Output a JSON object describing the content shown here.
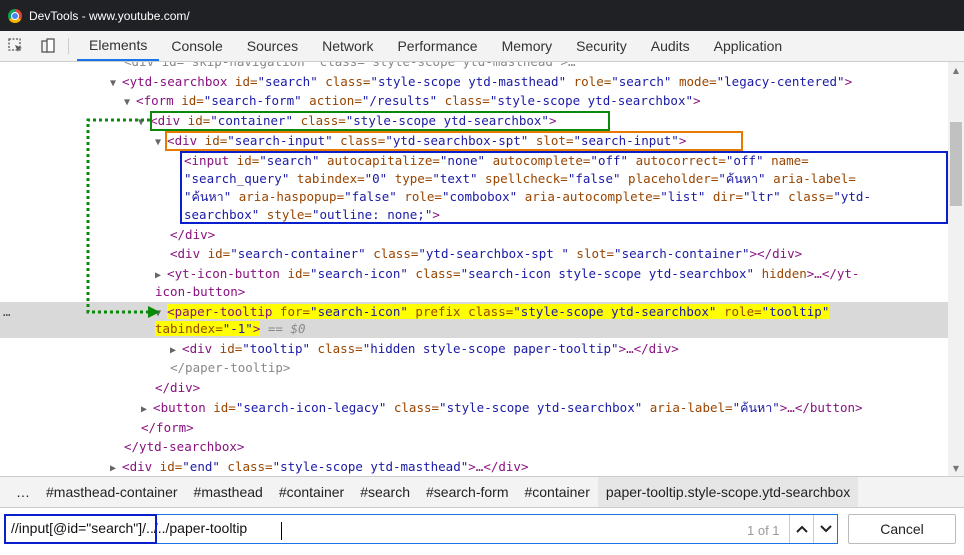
{
  "window": {
    "title": "DevTools - www.youtube.com/"
  },
  "toolbar": {
    "inspect_icon": "inspect-element-icon",
    "device_icon": "device-toolbar-icon",
    "tabs": [
      "Elements",
      "Console",
      "Sources",
      "Network",
      "Performance",
      "Memory",
      "Security",
      "Audits",
      "Application"
    ],
    "active_tab": "Elements"
  },
  "dom": {
    "l0": "<div id=\"skip-navigation\" class=\"style-scope ytd-masthead\">…",
    "l1": {
      "tag": "<ytd-searchbox",
      "a1": " id=",
      "v1": "\"search\"",
      "a2": " class=",
      "v2": "\"style-scope ytd-masthead\"",
      "a3": " role=",
      "v3": "\"search\"",
      "a4": " mode=",
      "v4": "\"legacy-centered\"",
      "end": ">"
    },
    "l2": {
      "tag": "<form",
      "a1": " id=",
      "v1": "\"search-form\"",
      "a2": " action=",
      "v2": "\"/results\"",
      "a3": " class=",
      "v3": "\"style-scope ytd-searchbox\"",
      "end": ">"
    },
    "l3": {
      "tag": "<div",
      "a1": " id=",
      "v1": "\"container\"",
      "a2": " class=",
      "v2": "\"style-scope ytd-searchbox\"",
      "end": ">"
    },
    "l4": {
      "tag": "<div",
      "a1": " id=",
      "v1": "\"search-input\"",
      "a2": " class=",
      "v2": "\"ytd-searchbox-spt\"",
      "a3": " slot=",
      "v3": "\"search-input\"",
      "end": ">"
    },
    "l5": {
      "tag": "<input",
      "a1": " id=",
      "v1": "\"search\"",
      "a2": " autocapitalize=",
      "v2": "\"none\"",
      "a3": " autocomplete=",
      "v3": "\"off\"",
      "a4": " autocorrect=",
      "v4": "\"off\"",
      "a5": " name="
    },
    "l6": {
      "v5": "\"search_query\"",
      "a6": " tabindex=",
      "v6": "\"0\"",
      "a7": " type=",
      "v7": "\"text\"",
      "a8": " spellcheck=",
      "v8": "\"false\"",
      "a9": " placeholder=",
      "v9": "\"ค้นหา\"",
      "a10": " aria-label="
    },
    "l7": {
      "v10": "\"ค้นหา\"",
      "a11": " aria-haspopup=",
      "v11": "\"false\"",
      "a12": " role=",
      "v12": "\"combobox\"",
      "a13": " aria-autocomplete=",
      "v13": "\"list\"",
      "a14": " dir=",
      "v14": "\"ltr\"",
      "a15": " class=",
      "v15": "\"ytd-"
    },
    "l8": {
      "v15b": "searchbox\"",
      "a16": " style=",
      "v16": "\"outline: none;\"",
      "end": ">"
    },
    "l9": "</div>",
    "l10": {
      "tag": "<div",
      "a1": " id=",
      "v1": "\"search-container\"",
      "a2": " class=",
      "v2": "\"ytd-searchbox-spt \"",
      "a3": " slot=",
      "v3": "\"search-container\"",
      "end": "></div>"
    },
    "l11": {
      "tag": "<yt-icon-button",
      "a1": " id=",
      "v1": "\"search-icon\"",
      "a2": " class=",
      "v2": "\"search-icon style-scope ytd-searchbox\"",
      "a3": " hidden",
      "end": ">…</yt-"
    },
    "l12": "icon-button>",
    "l13": {
      "tag": "<paper-tooltip",
      "a1": " for=",
      "v1": "\"search-icon\"",
      "a2": " prefix",
      "a3": " class=",
      "v3": "\"style-scope ytd-searchbox\"",
      "a4": " role=",
      "v4": "\"tooltip\""
    },
    "l14": {
      "a5": "tabindex=",
      "v5": "\"-1\"",
      "end": ">",
      "eq": " == $0"
    },
    "l15": {
      "tag": "<div",
      "a1": " id=",
      "v1": "\"tooltip\"",
      "a2": " class=",
      "v2": "\"hidden style-scope paper-tooltip\"",
      "end": ">…</div>"
    },
    "l16": "</paper-tooltip>",
    "l17": "</div>",
    "l18": {
      "tag": "<button",
      "a1": " id=",
      "v1": "\"search-icon-legacy\"",
      "a2": " class=",
      "v2": "\"style-scope ytd-searchbox\"",
      "a3": " aria-label=",
      "v3": "\"ค้นหา\"",
      "end": ">…</button>"
    },
    "l19": "</form>",
    "l20": "</ytd-searchbox>",
    "l21": {
      "tag": "<div",
      "a1": " id=",
      "v1": "\"end\"",
      "a2": " class=",
      "v2": "\"style-scope ytd-masthead\"",
      "end": ">…</div>"
    },
    "ellipsis": "…"
  },
  "breadcrumbs": {
    "more": "…",
    "items": [
      "#masthead-container",
      "#masthead",
      "#container",
      "#search",
      "#search-form",
      "#container",
      "paper-tooltip.style-scope.ytd-searchbox"
    ]
  },
  "search": {
    "query": "//input[@id=\"search\"]/../../paper-tooltip",
    "match_count": "1 of 1",
    "prev_icon": "chevron-up-icon",
    "next_icon": "chevron-down-icon",
    "cancel_label": "Cancel"
  },
  "colors": {
    "container_outline": "#0a8a0a",
    "search_input_outline": "#e87a00",
    "input_outline": "#0a1fcc",
    "selected_highlight": "#ffff00",
    "arrow": "#0a8a0a"
  }
}
